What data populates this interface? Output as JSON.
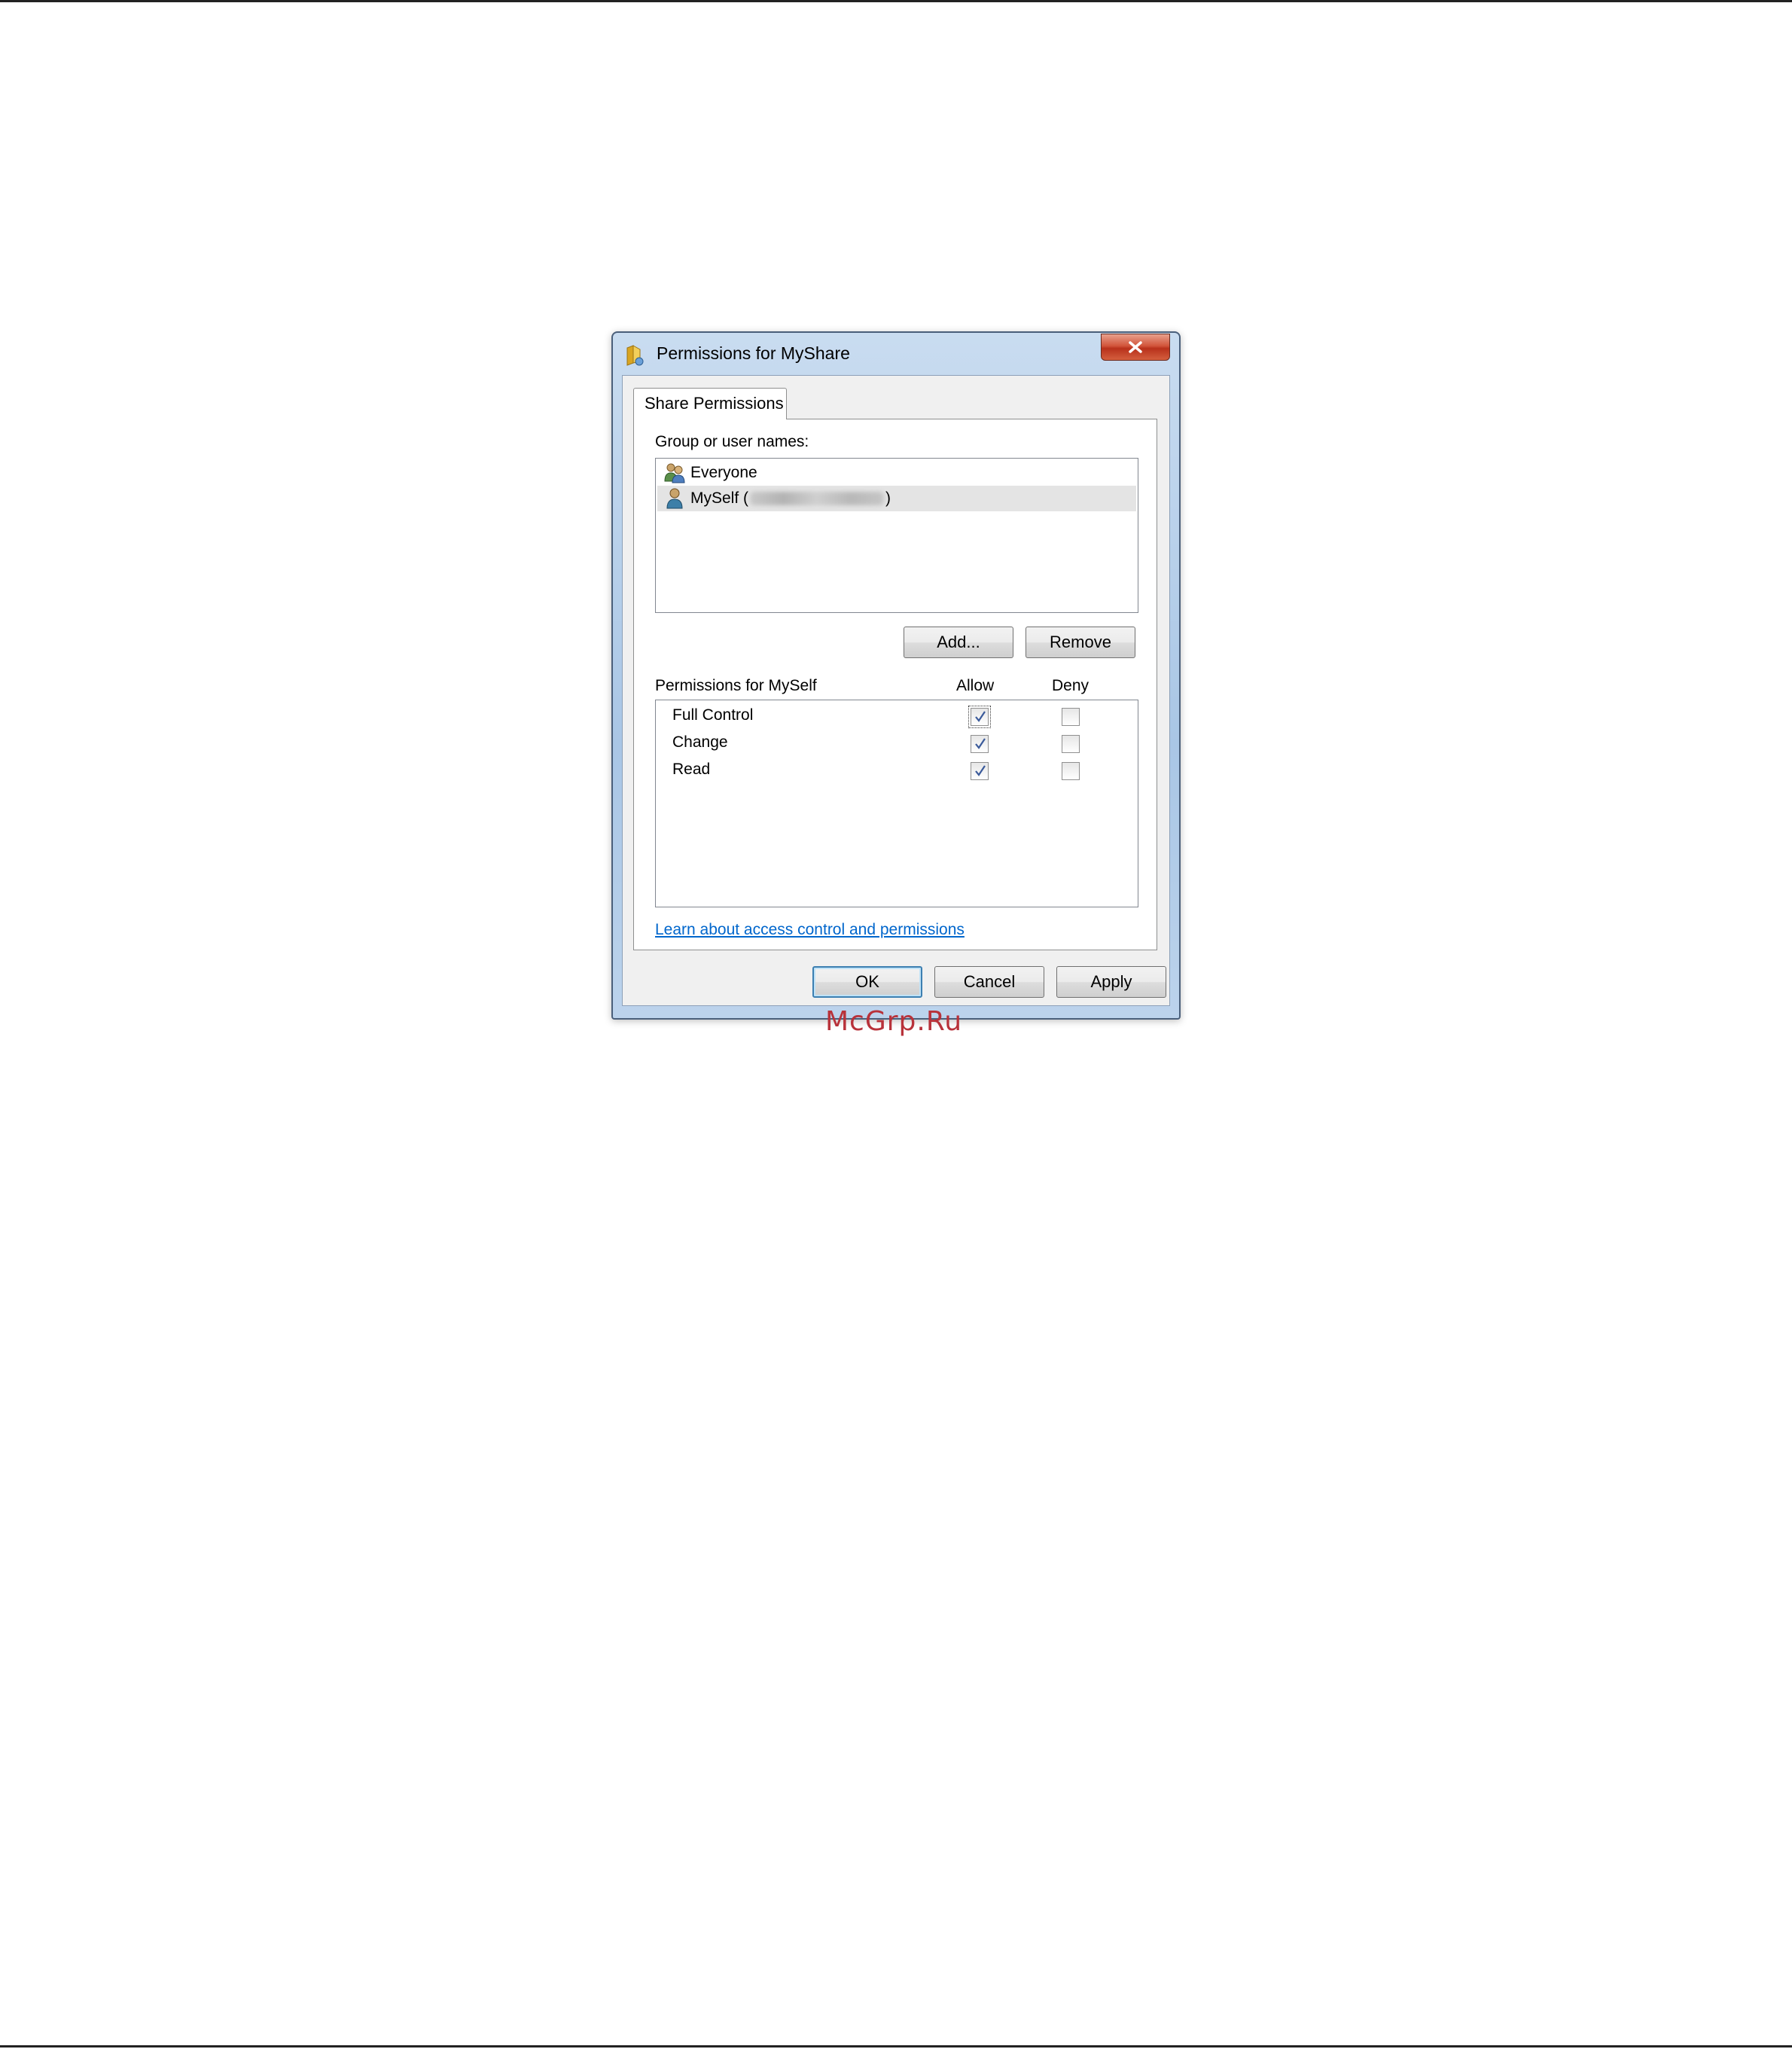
{
  "dialog": {
    "title": "Permissions for MyShare",
    "close_label": "X"
  },
  "tab": {
    "label": "Share Permissions"
  },
  "group": {
    "label": "Group or user names:",
    "users": [
      {
        "name": "Everyone",
        "icon": "group-users-icon",
        "selected": false
      },
      {
        "name": "MySelf (",
        "suffix": ")",
        "icon": "user-icon",
        "selected": true
      }
    ],
    "add_label": "Add...",
    "remove_label": "Remove"
  },
  "permissions": {
    "label": "Permissions for MySelf",
    "allow_header": "Allow",
    "deny_header": "Deny",
    "rows": [
      {
        "name": "Full Control",
        "allow": true,
        "deny": false
      },
      {
        "name": "Change",
        "allow": true,
        "deny": false
      },
      {
        "name": "Read",
        "allow": true,
        "deny": false
      }
    ]
  },
  "link_text": "Learn about access control and permissions",
  "buttons": {
    "ok": "OK",
    "cancel": "Cancel",
    "apply": "Apply"
  },
  "watermark": "McGrp.Ru",
  "colors": {
    "link": "#0066cc",
    "close_button": "#c8432b",
    "watermark": "#b8323a",
    "check": "#3a5a9a"
  }
}
